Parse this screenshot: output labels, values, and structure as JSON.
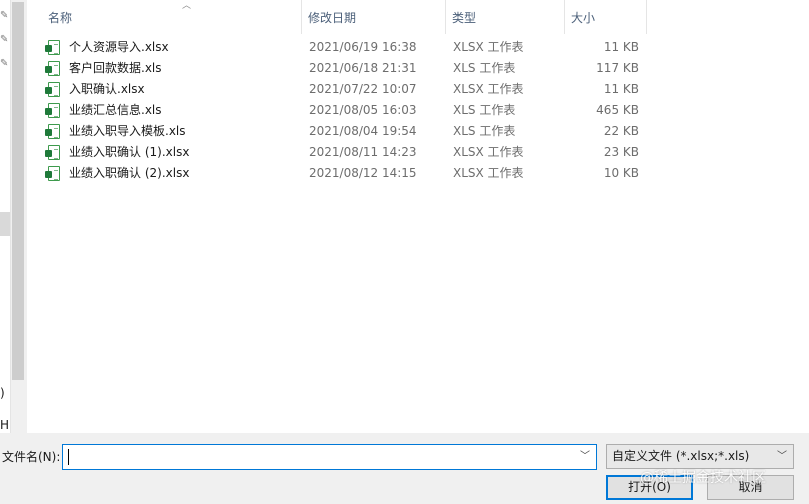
{
  "nav": {
    "fragment_paren": ")",
    "fragment_h": "H"
  },
  "columns": {
    "name": "名称",
    "date": "修改日期",
    "type": "类型",
    "size": "大小"
  },
  "files": [
    {
      "name": "个人资源导入.xlsx",
      "date": "2021/06/19 16:38",
      "type": "XLSX 工作表",
      "size": "11 KB"
    },
    {
      "name": "客户回款数据.xls",
      "date": "2021/06/18 21:31",
      "type": "XLS 工作表",
      "size": "117 KB"
    },
    {
      "name": "入职确认.xlsx",
      "date": "2021/07/22 10:07",
      "type": "XLSX 工作表",
      "size": "11 KB"
    },
    {
      "name": "业绩汇总信息.xls",
      "date": "2021/08/05 16:03",
      "type": "XLS 工作表",
      "size": "465 KB"
    },
    {
      "name": "业绩入职导入模板.xls",
      "date": "2021/08/04 19:54",
      "type": "XLS 工作表",
      "size": "22 KB"
    },
    {
      "name": "业绩入职确认 (1).xlsx",
      "date": "2021/08/11 14:23",
      "type": "XLSX 工作表",
      "size": "23 KB"
    },
    {
      "name": "业绩入职确认 (2).xlsx",
      "date": "2021/08/12 14:15",
      "type": "XLSX 工作表",
      "size": "10 KB"
    }
  ],
  "footer": {
    "filename_label": "文件名(N):",
    "filename_value": "",
    "filter": "自定义文件 (*.xlsx;*.xls)",
    "open_label": "打开(O)",
    "cancel_label": "取消",
    "watermark": "@稀土掘金技术社区"
  },
  "colors": {
    "accent": "#0078d7",
    "excel_green": "#1f7a3a",
    "header_text": "#4c607a"
  }
}
